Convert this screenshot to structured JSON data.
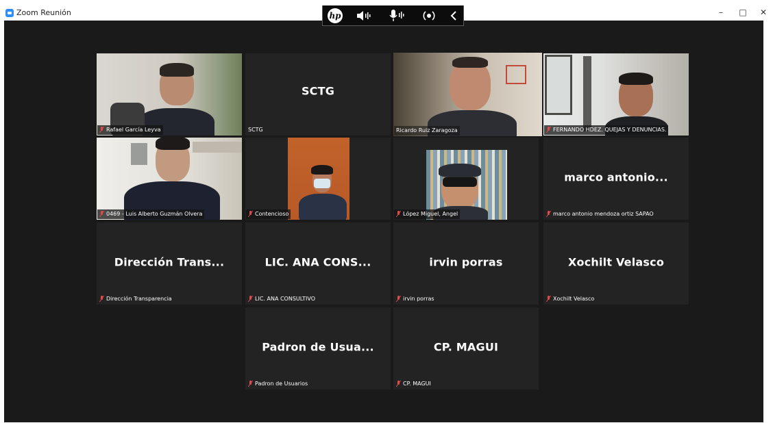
{
  "window": {
    "title": "Zoom Reunión",
    "controls": [
      "–",
      "□",
      "✕"
    ]
  },
  "overlay": {
    "icons": [
      "hp-logo-icon",
      "speaker-icon",
      "microphone-icon",
      "broadcast-icon",
      "chevron-left-icon"
    ],
    "hp_text": "hp"
  },
  "participants": [
    {
      "display": "",
      "label": "Rafael García Leyva",
      "video": true
    },
    {
      "display": "SCTG",
      "label": "SCTG",
      "video": false
    },
    {
      "display": "",
      "label": "Ricardo Ruiz Zaragoza",
      "video": true,
      "active_speaker": true
    },
    {
      "display": "",
      "label": "FERNANDO HDEZ. QUEJAS Y DENUNCIAS.",
      "video": true
    },
    {
      "display": "",
      "label": "0469 - Luis Alberto Guzmán Olvera",
      "video": true
    },
    {
      "display": "",
      "label": "Contencioso",
      "video": true
    },
    {
      "display": "",
      "label": "López Miguel, Angel",
      "video": true
    },
    {
      "display": "marco antonio...",
      "label": "marco antonio mendoza ortiz SAPAO",
      "video": false
    },
    {
      "display": "Dirección Trans...",
      "label": "Dirección Transparencia",
      "video": false
    },
    {
      "display": "LIC. ANA CONS...",
      "label": "LIC. ANA CONSULTIVO",
      "video": false
    },
    {
      "display": "irvin porras",
      "label": "irvin porras",
      "video": false
    },
    {
      "display": "Xochilt Velasco",
      "label": "Xochilt Velasco",
      "video": false
    },
    {
      "display": "Padron de Usua...",
      "label": "Padron de Usuarios",
      "video": false
    },
    {
      "display": "CP. MAGUI",
      "label": "CP. MAGUI",
      "video": false
    }
  ],
  "colors": {
    "meeting_bg": "#1a1a1a",
    "tile_bg": "#232323",
    "active_speaker_border": "#a9d04b",
    "muted_mic": "#e24b4b",
    "zoom_blue": "#2d8cff"
  }
}
